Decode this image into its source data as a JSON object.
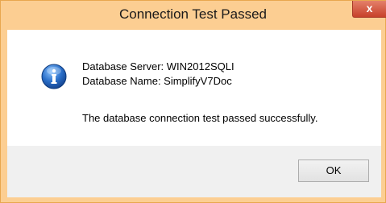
{
  "window": {
    "title": "Connection Test Passed",
    "close_label": "x"
  },
  "message": {
    "icon": "info-icon",
    "server_line": "Database Server: WIN2012SQLI",
    "name_line": "Database Name: SimplifyV7Doc",
    "result_line": "The database connection test passed successfully."
  },
  "buttons": {
    "ok_label": "OK"
  },
  "colors": {
    "frame": "#fcce92",
    "close_button": "#c7412a",
    "content_bg": "#ffffff",
    "footer_bg": "#f0f0f0",
    "info_icon": "#2a6fc9"
  }
}
